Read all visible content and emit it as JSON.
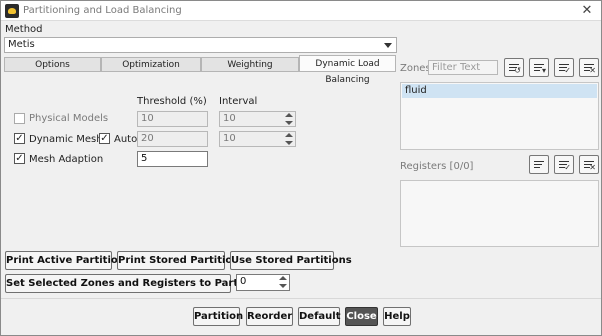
{
  "window": {
    "title": "Partitioning and Load Balancing",
    "close_glyph": "✕"
  },
  "method": {
    "label": "Method",
    "value": "Metis"
  },
  "tabs": [
    {
      "label": "Options"
    },
    {
      "label": "Optimization"
    },
    {
      "label": "Weighting"
    },
    {
      "label": "Dynamic Load Balancing",
      "active": true
    }
  ],
  "dlb": {
    "threshold_header": "Threshold (%)",
    "interval_header": "Interval",
    "physical_models": {
      "label": "Physical Models",
      "checked": false,
      "threshold": "10",
      "interval": "10"
    },
    "dynamic_mesh": {
      "label": "Dynamic Mesh",
      "checked": true,
      "auto_label": "Auto",
      "auto_checked": true,
      "threshold": "20",
      "interval": "10"
    },
    "mesh_adaption": {
      "label": "Mesh Adaption",
      "checked": true,
      "threshold": "5"
    }
  },
  "zones": {
    "label": "Zones",
    "filter_placeholder": "Filter Text",
    "items": [
      "fluid"
    ]
  },
  "registers": {
    "label": "Registers [0/0]"
  },
  "actions": {
    "print_active": "Print Active Partitions",
    "print_stored": "Print Stored Partitions",
    "use_stored": "Use Stored Partitions",
    "set_selected": "Set Selected Zones and Registers to Partition ID",
    "partition_id": "0"
  },
  "footer": {
    "partition": "Partition",
    "reorder": "Reorder",
    "default": "Default",
    "close": "Close",
    "help": "Help"
  },
  "checkmark": "✓"
}
